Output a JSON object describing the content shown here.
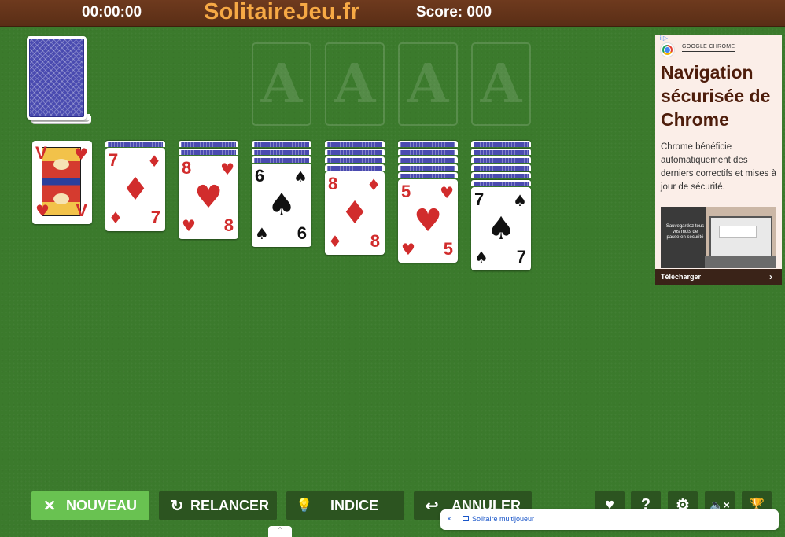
{
  "header": {
    "timer": "00:00:00",
    "brand": "SolitaireJeu.fr",
    "score": "Score: 000"
  },
  "foundations": [
    "A",
    "A",
    "A",
    "A"
  ],
  "tableau": [
    {
      "rank": "V",
      "suit": "♥",
      "color": "red"
    },
    {
      "rank": "7",
      "suit": "♦",
      "color": "red"
    },
    {
      "rank": "8",
      "suit": "♥",
      "color": "red"
    },
    {
      "rank": "6",
      "suit": "♠",
      "color": "black"
    },
    {
      "rank": "8",
      "suit": "♦",
      "color": "red"
    },
    {
      "rank": "5",
      "suit": "♥",
      "color": "red"
    },
    {
      "rank": "7",
      "suit": "♠",
      "color": "black"
    }
  ],
  "ad": {
    "brand": "GOOGLE CHROME",
    "headline": "Navigation sécurisée de Chrome",
    "body": "Chrome bénéficie automatiquement des derniers correctifs et mises à jour de sécurité.",
    "image_text": "Sauvegardez tous vos mots de passe en sécurité",
    "cta": "Télécharger",
    "cta_icon": "›",
    "adchoices": "i ▷"
  },
  "buttons": {
    "nouveau": "NOUVEAU",
    "relancer": "RELANCER",
    "indice": "INDICE",
    "annuler": "ANNULER"
  },
  "icons": {
    "nouveau": "✕",
    "relancer": "↻",
    "indice": "💡",
    "annuler": "↩",
    "heart": "♥",
    "help": "?",
    "settings": "⚙",
    "mute": "🔈×",
    "trophy": "🏆"
  },
  "toast": {
    "close": "×",
    "label": "Solitaire multijoueur"
  },
  "bottom_tab": "⌃"
}
